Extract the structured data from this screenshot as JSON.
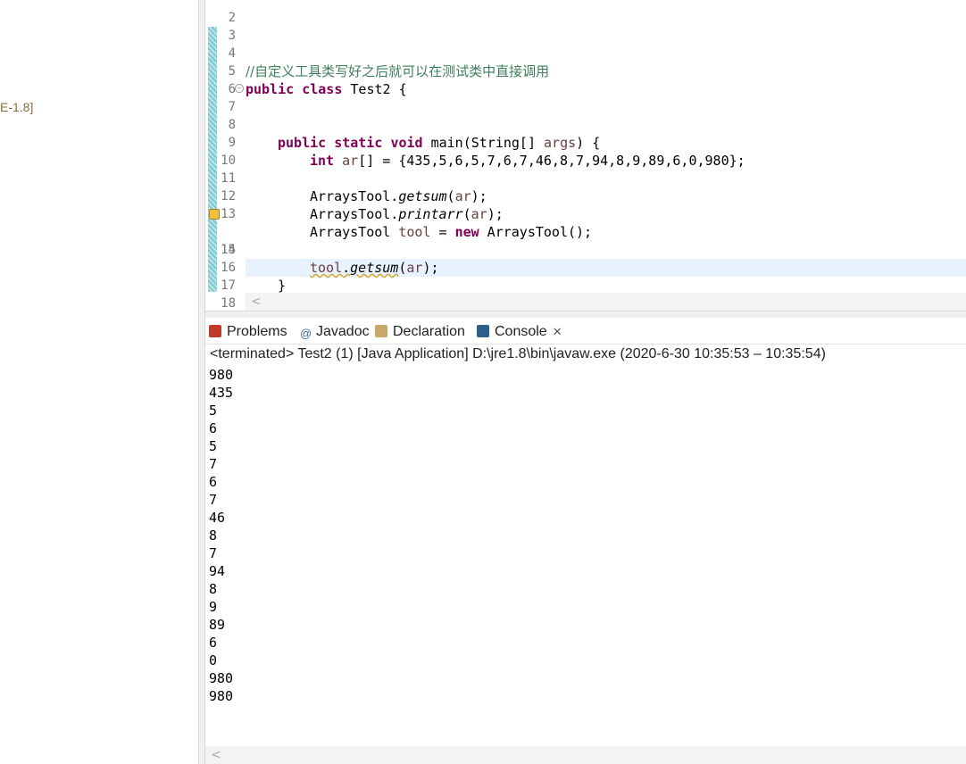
{
  "left_pane": {
    "jre_label": "E-1.8]"
  },
  "editor": {
    "lines": [
      {
        "n": "2"
      },
      {
        "n": "3"
      },
      {
        "n": "4",
        "comment": "//自定义工具类写好之后就可以在测试类中直接调用"
      },
      {
        "n": "5",
        "kw1": "public",
        "kw2": "class",
        "rest": " Test2 {"
      },
      {
        "n": "6"
      },
      {
        "n": "7",
        "kw1": "public",
        "kw2": "static",
        "kw3": "void",
        "rest": " main(String[] ",
        "param": "args",
        "rest2": ") {"
      },
      {
        "n": "8"
      },
      {
        "n": "9",
        "kw1": "int",
        "var": "ar",
        "rest": "[] = {435,5,6,5,7,6,7,46,8,7,94,8,9,89,6,0,980};"
      },
      {
        "n": "10"
      },
      {
        "n": "11",
        "cls": "ArraysTool.",
        "method": "getsum",
        "open": "(",
        "var": "ar",
        "close": ");"
      },
      {
        "n": "12",
        "cls": "ArraysTool.",
        "method": "printarr",
        "open": "(",
        "var": "ar",
        "close": ");"
      },
      {
        "n": "13",
        "cls": "ArraysTool ",
        "var": "tool",
        "eq": " = ",
        "kw": "new",
        "rest": " ArraysTool();"
      },
      {
        "n": "14",
        "var": "tool",
        "dot": ".",
        "method": "getsum",
        "open": "(",
        "var2": "ar",
        "close": ");"
      },
      {
        "n": "15"
      },
      {
        "n": "16",
        "rest": "}"
      },
      {
        "n": "17"
      },
      {
        "n": "18",
        "rest": "}"
      }
    ],
    "hscroll_arrow": "<"
  },
  "tabs": [
    {
      "label": "Problems",
      "icon": "problems-icon",
      "color": "#c0392b"
    },
    {
      "label": "Javadoc",
      "icon": "javadoc-icon",
      "color": "#3a6ea5"
    },
    {
      "label": "Declaration",
      "icon": "declaration-icon",
      "color": "#8a6d3b"
    },
    {
      "label": "Console",
      "icon": "console-icon",
      "color": "#2c5f8a"
    }
  ],
  "console": {
    "header": "<terminated> Test2 (1) [Java Application] D:\\jre1.8\\bin\\javaw.exe  (2020-6-30 10:35:53 – 10:35:54)",
    "output": [
      "980",
      "435",
      "5",
      "6",
      "5",
      "7",
      "6",
      "7",
      "46",
      "8",
      "7",
      "94",
      "8",
      "9",
      "89",
      "6",
      "0",
      "980",
      "980"
    ],
    "hscroll_arrow": "<"
  }
}
